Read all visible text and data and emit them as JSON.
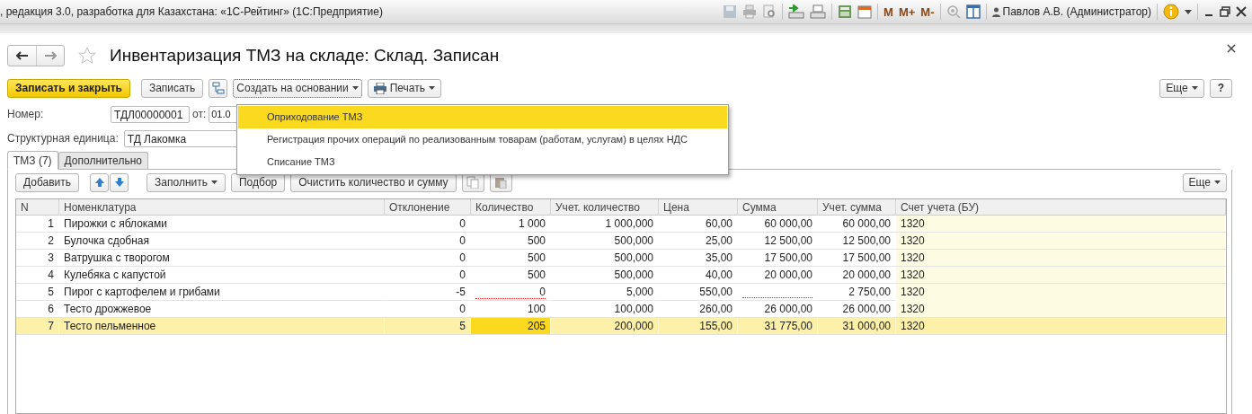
{
  "window": {
    "title": ", редакция 3.0, разработка для Казахстана: «1С-Рейтинг»  (1С:Предприятие)",
    "memory_buttons": [
      "M",
      "M+",
      "M-"
    ],
    "user": "Павлов А.В. (Администратор)"
  },
  "form": {
    "title": "Инвентаризация ТМЗ на складе: Склад. Записан",
    "favorite": false
  },
  "toolbar": {
    "primary": "Записать и закрыть",
    "save": "Записать",
    "create_based_on": "Создать на основании",
    "print": "Печать",
    "more": "Еще",
    "help": "?"
  },
  "create_menu": {
    "items": [
      {
        "label": "Оприходование ТМЗ",
        "selected": true
      },
      {
        "label": "Регистрация прочих операций по реализованным товарам (работам, услугам) в целях НДС",
        "selected": false
      },
      {
        "label": "Списание ТМЗ",
        "selected": false
      }
    ]
  },
  "fields": {
    "number_label": "Номер:",
    "number": "ТДЛ00000001",
    "date_label": "от:",
    "date": "01.0",
    "unit_label": "Структурная единица:",
    "unit": "ТД Лакомка"
  },
  "tabs": [
    {
      "label": "ТМЗ (7)",
      "selected": true
    },
    {
      "label": "Дополнительно",
      "selected": false
    }
  ],
  "table_toolbar": {
    "add": "Добавить",
    "fill": "Заполнить",
    "pick": "Подбор",
    "clear": "Очистить количество и сумму",
    "more": "Еще"
  },
  "table": {
    "columns": [
      "N",
      "Номенклатура",
      "Отклонение",
      "Количество",
      "Учет. количество",
      "Цена",
      "Сумма",
      "Учет. сумма",
      "Счет учета (БУ)"
    ],
    "rows": [
      {
        "n": "1",
        "name": "Пирожки с яблоками",
        "deviation": "0",
        "quantity": "1 000",
        "acc_quantity": "1 000,000",
        "price": "60,00",
        "sum": "60 000,00",
        "acc_sum": "60 000,00",
        "account": "1320",
        "selected": false,
        "quantity_invalid": false,
        "sum_invalid": false,
        "quantity_focused": false
      },
      {
        "n": "2",
        "name": "Булочка сдобная",
        "deviation": "0",
        "quantity": "500",
        "acc_quantity": "500,000",
        "price": "25,00",
        "sum": "12 500,00",
        "acc_sum": "12 500,00",
        "account": "1320",
        "selected": false,
        "quantity_invalid": false,
        "sum_invalid": false,
        "quantity_focused": false
      },
      {
        "n": "3",
        "name": "Ватрушка с творогом",
        "deviation": "0",
        "quantity": "500",
        "acc_quantity": "500,000",
        "price": "35,00",
        "sum": "17 500,00",
        "acc_sum": "17 500,00",
        "account": "1320",
        "selected": false,
        "quantity_invalid": false,
        "sum_invalid": false,
        "quantity_focused": false
      },
      {
        "n": "4",
        "name": "Кулебяка с капустой",
        "deviation": "0",
        "quantity": "500",
        "acc_quantity": "500,000",
        "price": "40,00",
        "sum": "20 000,00",
        "acc_sum": "20 000,00",
        "account": "1320",
        "selected": false,
        "quantity_invalid": false,
        "sum_invalid": false,
        "quantity_focused": false
      },
      {
        "n": "5",
        "name": "Пирог с картофелем и грибами",
        "deviation": "-5",
        "quantity": "0",
        "acc_quantity": "5,000",
        "price": "550,00",
        "sum": "",
        "acc_sum": "2 750,00",
        "account": "1320",
        "selected": false,
        "quantity_invalid": true,
        "sum_invalid": true,
        "quantity_focused": false
      },
      {
        "n": "6",
        "name": "Тесто дрожжевое",
        "deviation": "0",
        "quantity": "100",
        "acc_quantity": "100,000",
        "price": "260,00",
        "sum": "26 000,00",
        "acc_sum": "26 000,00",
        "account": "1320",
        "selected": false,
        "quantity_invalid": false,
        "sum_invalid": false,
        "quantity_focused": false
      },
      {
        "n": "7",
        "name": "Тесто пельменное",
        "deviation": "5",
        "quantity": "205",
        "acc_quantity": "200,000",
        "price": "155,00",
        "sum": "31 775,00",
        "acc_sum": "31 000,00",
        "account": "1320",
        "selected": true,
        "quantity_invalid": false,
        "sum_invalid": false,
        "quantity_focused": true
      }
    ]
  }
}
